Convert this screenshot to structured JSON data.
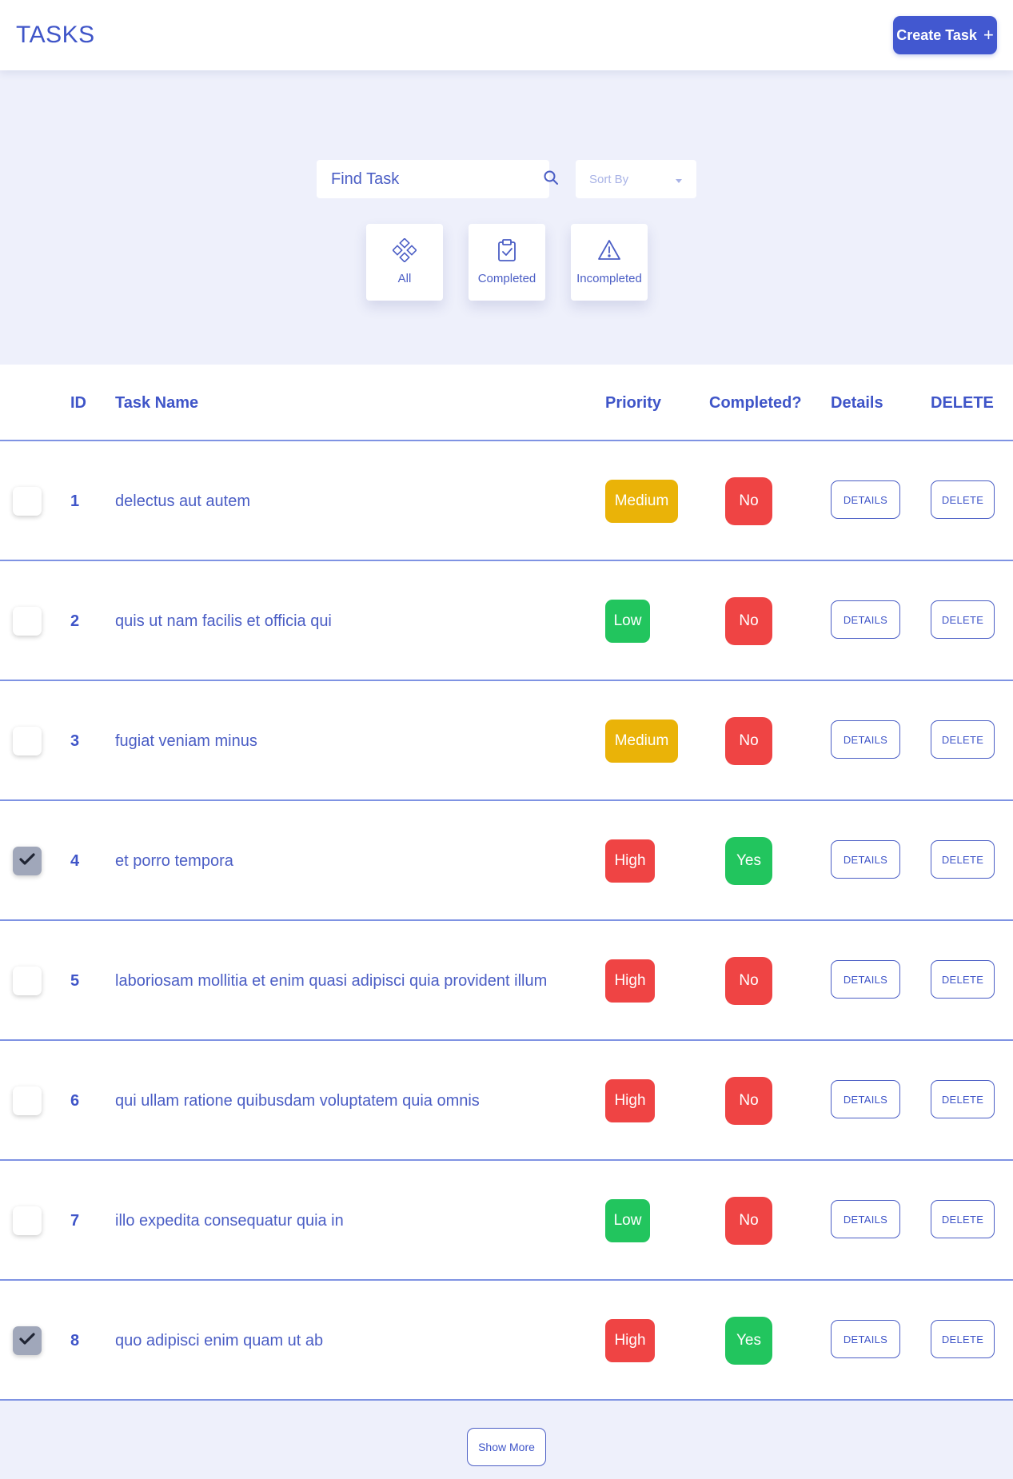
{
  "header": {
    "title": "TASKS",
    "create_label": "Create Task",
    "create_icon": "plus-icon"
  },
  "search": {
    "placeholder": "Find Task",
    "value": "",
    "icon": "search-icon"
  },
  "sort": {
    "label": "Sort By",
    "icon": "caret-down-icon"
  },
  "filters": [
    {
      "label": "All",
      "icon": "grid-diamond-icon"
    },
    {
      "label": "Completed",
      "icon": "clipboard-check-icon"
    },
    {
      "label": "Incompleted",
      "icon": "warning-triangle-icon"
    }
  ],
  "table": {
    "headers": {
      "id": "ID",
      "name": "Task Name",
      "priority": "Priority",
      "completed": "Completed?",
      "details": "Details",
      "delete": "DELETE"
    },
    "details_button_label": "DETAILS",
    "delete_button_label": "DELETE",
    "rows": [
      {
        "checked": false,
        "id": "1",
        "name": "delectus aut autem",
        "priority": "Medium",
        "completed": "No"
      },
      {
        "checked": false,
        "id": "2",
        "name": "quis ut nam facilis et officia qui",
        "priority": "Low",
        "completed": "No"
      },
      {
        "checked": false,
        "id": "3",
        "name": "fugiat veniam minus",
        "priority": "Medium",
        "completed": "No"
      },
      {
        "checked": true,
        "id": "4",
        "name": "et porro tempora",
        "priority": "High",
        "completed": "Yes"
      },
      {
        "checked": false,
        "id": "5",
        "name": "laboriosam mollitia et enim quasi adipisci quia provident illum",
        "priority": "High",
        "completed": "No"
      },
      {
        "checked": false,
        "id": "6",
        "name": "qui ullam ratione quibusdam voluptatem quia omnis",
        "priority": "High",
        "completed": "No"
      },
      {
        "checked": false,
        "id": "7",
        "name": "illo expedita consequatur quia in",
        "priority": "Low",
        "completed": "No"
      },
      {
        "checked": true,
        "id": "8",
        "name": "quo adipisci enim quam ut ab",
        "priority": "High",
        "completed": "Yes"
      }
    ]
  },
  "show_more_label": "Show More",
  "colors": {
    "accent": "#4258d0",
    "text": "#4b5ec5",
    "background": "#eef0fb",
    "priority_medium": "#eab308",
    "priority_low": "#22c55e",
    "priority_high": "#ef4444",
    "completed_yes": "#22c55e",
    "completed_no": "#ef4444",
    "checkbox_checked": "#a0a7ba"
  }
}
